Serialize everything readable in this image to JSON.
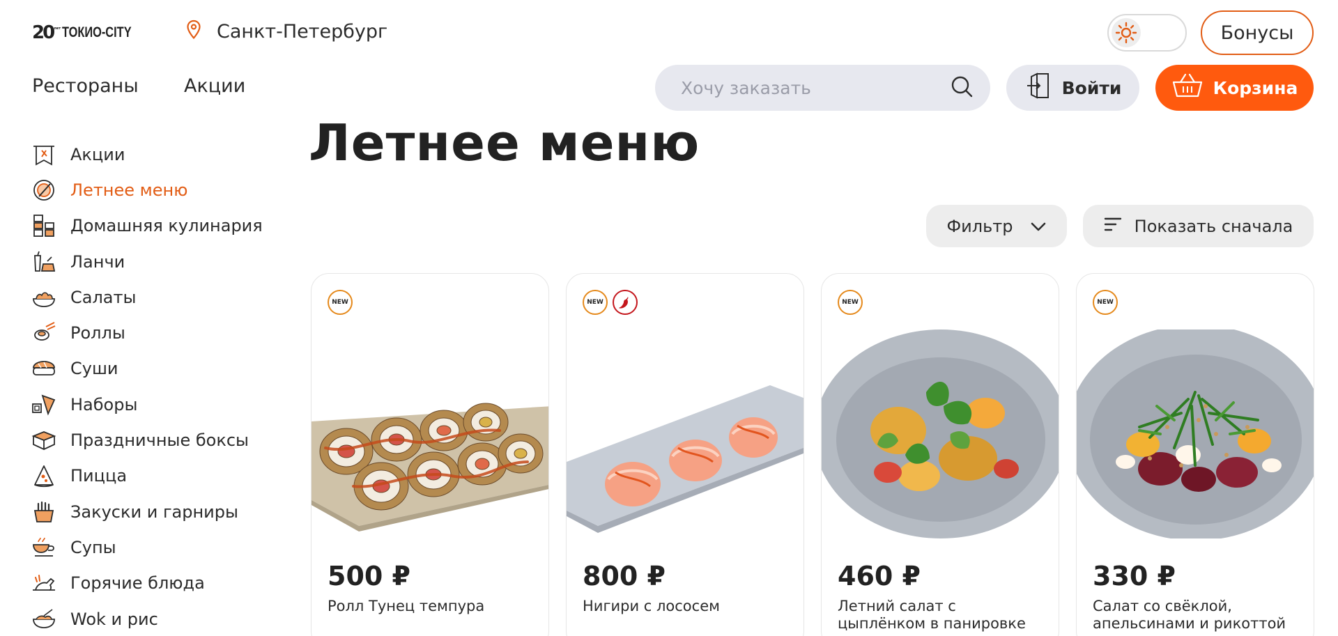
{
  "header": {
    "logo": {
      "number": "20",
      "sub": "лет",
      "name": "ТОКИО-CITY"
    },
    "city": "Санкт-Петербург",
    "theme_toggle": {
      "state": "light",
      "icon": "sun-icon"
    },
    "bonus_label": "Бонусы",
    "nav": [
      {
        "label": "Рестораны"
      },
      {
        "label": "Акции"
      }
    ],
    "search": {
      "placeholder": "Хочу заказать",
      "value": ""
    },
    "login_label": "Войти",
    "cart_label": "Корзина"
  },
  "colors": {
    "accent": "#ff5a0e",
    "accent_dark": "#e25c14",
    "badge_new": "#e5891b",
    "badge_spicy": "#c4161c",
    "pill_bg": "#e7e8ef"
  },
  "sidebar": {
    "items": [
      {
        "label": "Акции",
        "icon": "promo-flag-icon",
        "active": false
      },
      {
        "label": "Летнее меню",
        "icon": "summer-plate-icon",
        "active": true
      },
      {
        "label": "Домашняя кулинария",
        "icon": "home-cooking-icon",
        "active": false
      },
      {
        "label": "Ланчи",
        "icon": "lunch-icon",
        "active": false
      },
      {
        "label": "Салаты",
        "icon": "salad-icon",
        "active": false
      },
      {
        "label": "Роллы",
        "icon": "roll-icon",
        "active": false
      },
      {
        "label": "Суши",
        "icon": "sushi-icon",
        "active": false
      },
      {
        "label": "Наборы",
        "icon": "set-icon",
        "active": false
      },
      {
        "label": "Праздничные боксы",
        "icon": "gift-box-icon",
        "active": false
      },
      {
        "label": "Пицца",
        "icon": "pizza-icon",
        "active": false
      },
      {
        "label": "Закуски и гарниры",
        "icon": "fries-icon",
        "active": false
      },
      {
        "label": "Супы",
        "icon": "soup-icon",
        "active": false
      },
      {
        "label": "Горячие блюда",
        "icon": "hot-dish-icon",
        "active": false
      },
      {
        "label": "Wok и рис",
        "icon": "wok-icon",
        "active": false
      }
    ]
  },
  "main": {
    "title": "Летнее меню",
    "filter_label": "Фильтр",
    "sort_label": "Показать сначала",
    "products": [
      {
        "price": "500 ₽",
        "name": "Ролл Тунец темпура",
        "badges": [
          "NEW"
        ],
        "spicy": false
      },
      {
        "price": "800 ₽",
        "name": "Нигири с лососем",
        "badges": [
          "NEW"
        ],
        "spicy": true
      },
      {
        "price": "460 ₽",
        "name": "Летний салат с цыплёнком в панировке",
        "badges": [
          "NEW"
        ],
        "spicy": false
      },
      {
        "price": "330 ₽",
        "name": "Салат со свёклой, апельсинами и рикоттой",
        "badges": [
          "NEW"
        ],
        "spicy": false
      }
    ]
  }
}
